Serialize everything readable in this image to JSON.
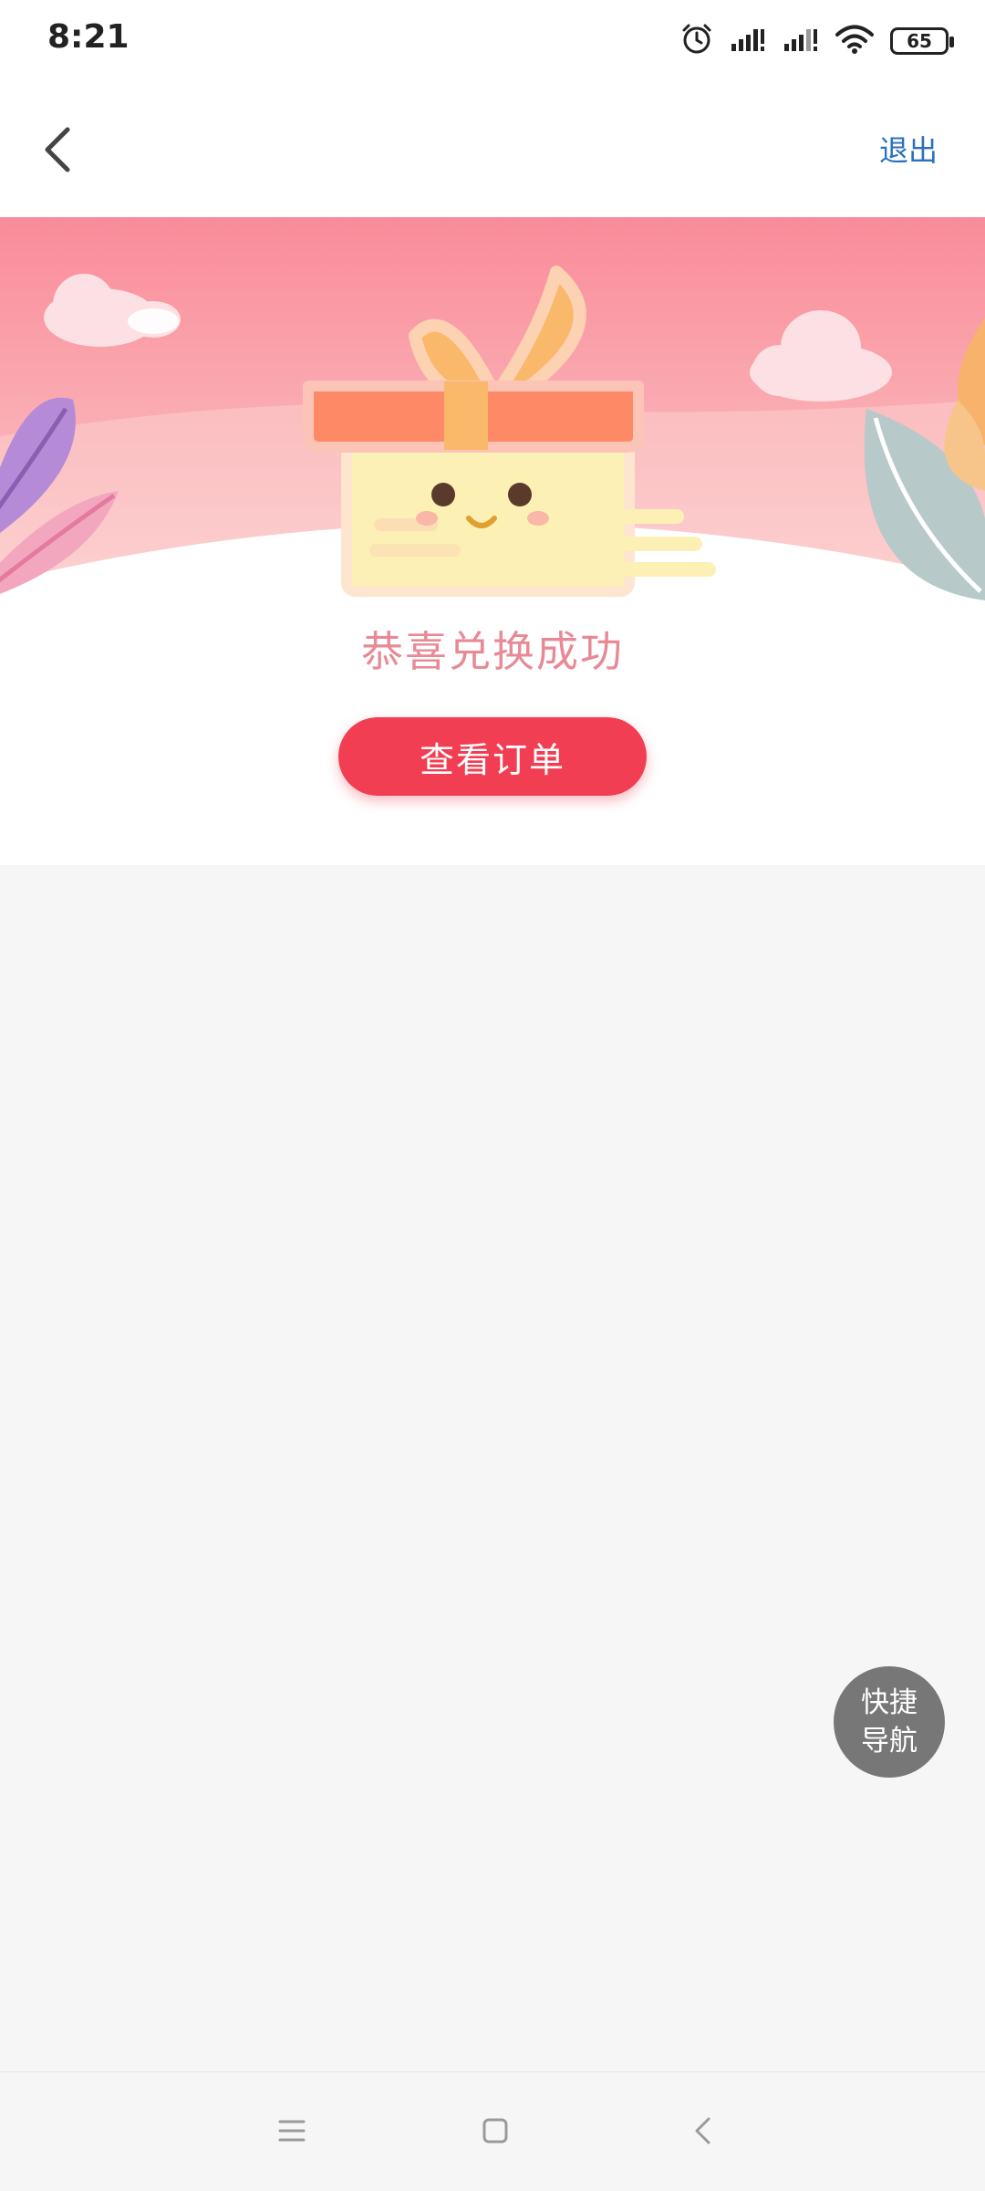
{
  "status_bar": {
    "time": "8:21",
    "battery": "65",
    "icons": [
      "alarm-icon",
      "signal-icon",
      "signal-icon",
      "wifi-icon",
      "battery-icon"
    ]
  },
  "header": {
    "back_icon": "chevron-left-icon",
    "exit_label": "退出",
    "exit_color": "#2a6fc0"
  },
  "main": {
    "success_message": "恭喜兑换成功",
    "view_order_label": "查看订单",
    "accent_color": "#f23e52"
  },
  "quick_nav": {
    "line1": "快捷",
    "line2": "导航"
  },
  "system_nav": {
    "icons": [
      "menu-icon",
      "home-icon",
      "back-icon"
    ]
  }
}
